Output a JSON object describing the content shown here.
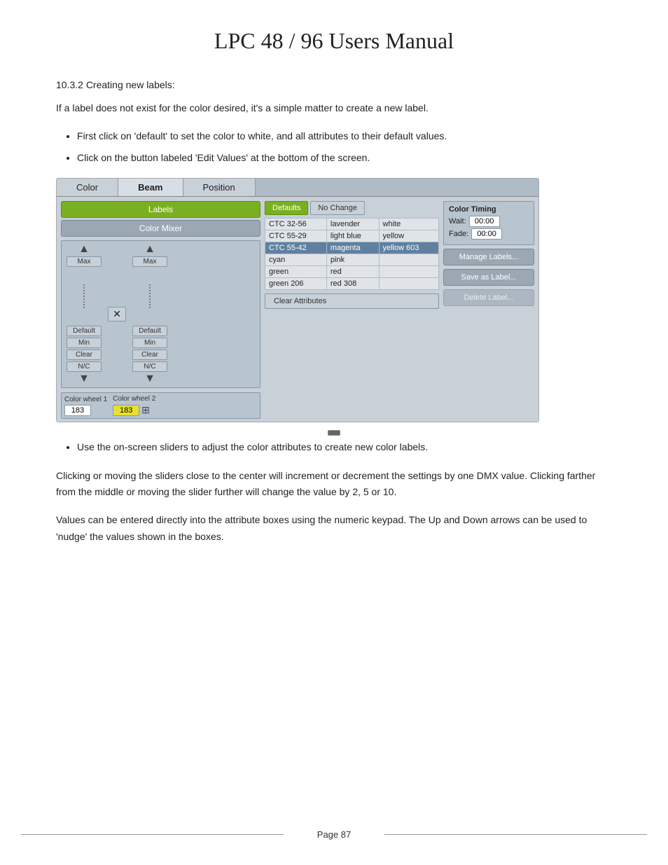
{
  "page": {
    "title": "LPC 48 / 96 Users Manual",
    "footer_text": "Page 87"
  },
  "section": {
    "heading": "10.3.2      Creating new labels:",
    "intro": "If a label does not exist for the color desired, it's a simple matter to create a new label.",
    "bullets": [
      "First click on 'default' to set the color to white, and all attributes to their default values.",
      "Click on the button labeled 'Edit Values' at the bottom of the screen."
    ],
    "bullet2": "Use the on-screen sliders to adjust the color attributes to create new color labels.",
    "para1": "Clicking or moving the sliders close to the center will increment or decrement the settings by one DMX value.  Clicking farther from the middle or moving the slider further will change the value by 2, 5 or 10.",
    "para2": "Values can be entered directly into the attribute boxes using the numeric keypad. The Up and Down arrows can be used to 'nudge' the values shown in the boxes."
  },
  "ui": {
    "tabs": [
      "Color",
      "Beam",
      "Position"
    ],
    "active_tab": "Beam",
    "left_panel": {
      "labels_btn": "Labels",
      "color_mixer_btn": "Color Mixer",
      "slider_cols": [
        {
          "top_label": "Max",
          "bottom_labels": [
            "Default",
            "Min",
            "Clear",
            "N/C"
          ]
        },
        {
          "top_label": "Max",
          "bottom_labels": [
            "Default",
            "Min",
            "Clear",
            "N/C"
          ]
        }
      ],
      "colorwheel1_label": "Color wheel 1",
      "colorwheel2_label": "Color wheel 2",
      "colorwheel1_val": "183",
      "colorwheel2_val": "183"
    },
    "center_panel": {
      "defaults_btn": "Defaults",
      "no_change_btn": "No Change",
      "color_rows": [
        {
          "col1": "CTC 32-56",
          "col2": "lavender",
          "col3": "white",
          "selected": false
        },
        {
          "col1": "CTC 55-29",
          "col2": "light blue",
          "col3": "yellow",
          "selected": false
        },
        {
          "col1": "CTC 55-42",
          "col2": "magenta",
          "col3": "yellow 603",
          "selected": true
        },
        {
          "col1": "cyan",
          "col2": "pink",
          "col3": "",
          "selected": false
        },
        {
          "col1": "green",
          "col2": "red",
          "col3": "",
          "selected": false
        },
        {
          "col1": "green 206",
          "col2": "red 308",
          "col3": "",
          "selected": false
        }
      ],
      "clear_attrs_btn": "Clear Attributes"
    },
    "right_panel": {
      "timing_title": "Color Timing",
      "wait_label": "Wait:",
      "wait_val": "00:00",
      "fade_label": "Fade:",
      "fade_val": "00:00",
      "manage_labels_btn": "Manage Labels...",
      "save_as_label_btn": "Save as Label...",
      "delete_label_btn": "Delete Label..."
    }
  }
}
